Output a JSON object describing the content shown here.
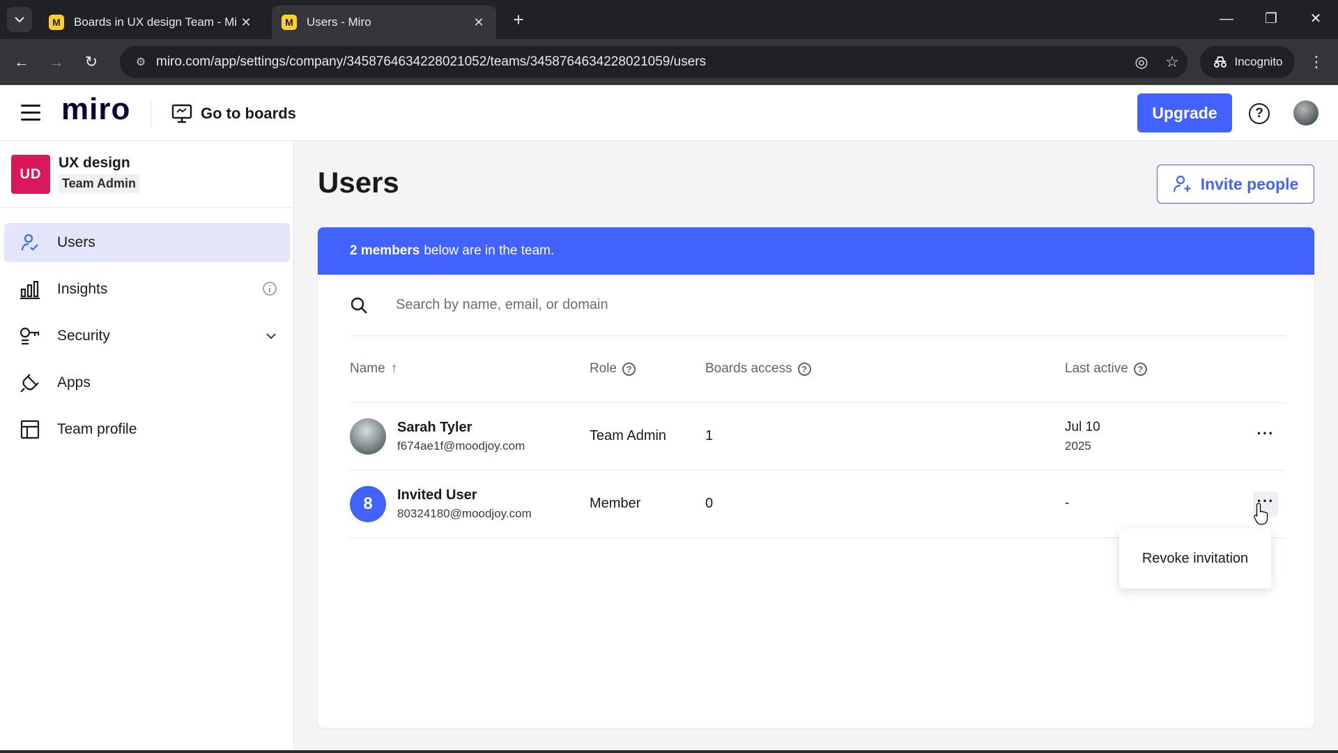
{
  "browser": {
    "tabs": [
      {
        "title": "Boards in UX design Team - Mi",
        "favicon": "M",
        "active": false
      },
      {
        "title": "Users - Miro",
        "favicon": "M",
        "active": true
      }
    ],
    "url": "miro.com/app/settings/company/3458764634228021052/teams/3458764634228021059/users",
    "incognito_label": "Incognito"
  },
  "header": {
    "logo": "miro",
    "go_to_boards": "Go to boards",
    "upgrade_label": "Upgrade",
    "help_glyph": "?"
  },
  "sidebar": {
    "team_badge": "UD",
    "team_name": "UX design",
    "team_role": "Team Admin",
    "items": [
      {
        "label": "Users",
        "icon": "user-icon",
        "active": true
      },
      {
        "label": "Insights",
        "icon": "bar-chart-icon",
        "active": false
      },
      {
        "label": "Security",
        "icon": "key-icon",
        "active": false
      },
      {
        "label": "Apps",
        "icon": "plug-icon",
        "active": false
      },
      {
        "label": "Team profile",
        "icon": "layout-icon",
        "active": false
      }
    ]
  },
  "main": {
    "title": "Users",
    "invite_label": "Invite people",
    "banner_bold": "2 members",
    "banner_rest": "below are in the team.",
    "search_placeholder": "Search by name, email, or domain",
    "columns": {
      "name": "Name",
      "name_sort": "↑",
      "role": "Role",
      "boards_access": "Boards access",
      "last_active": "Last active"
    },
    "rows": [
      {
        "name": "Sarah Tyler",
        "email": "f674ae1f@moodjoy.com",
        "role": "Team Admin",
        "boards": "1",
        "last_active_date": "Jul 10",
        "last_active_year": "2025",
        "avatar": "photo"
      },
      {
        "name": "Invited User",
        "email": "80324180@moodjoy.com",
        "role": "Member",
        "boards": "0",
        "last_active": "-",
        "avatar_letter": "8"
      }
    ],
    "more_glyph": "···",
    "dropdown_item": "Revoke invitation"
  },
  "colors": {
    "accent": "#4262ff",
    "team_badge": "#d9175a",
    "active_nav": "#e3e6fb"
  }
}
